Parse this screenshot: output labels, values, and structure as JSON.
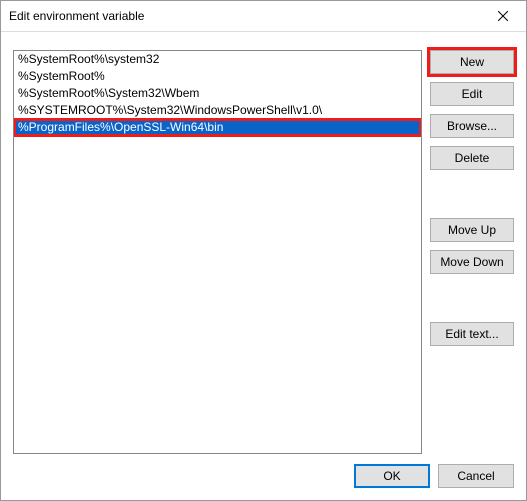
{
  "window": {
    "title": "Edit environment variable"
  },
  "list": {
    "items": [
      {
        "text": "%SystemRoot%\\system32",
        "selected": false,
        "highlight": false
      },
      {
        "text": "%SystemRoot%",
        "selected": false,
        "highlight": false
      },
      {
        "text": "%SystemRoot%\\System32\\Wbem",
        "selected": false,
        "highlight": false
      },
      {
        "text": "%SYSTEMROOT%\\System32\\WindowsPowerShell\\v1.0\\",
        "selected": false,
        "highlight": false
      },
      {
        "text": "%ProgramFiles%\\OpenSSL-Win64\\bin",
        "selected": true,
        "highlight": true
      }
    ]
  },
  "buttons": {
    "new": "New",
    "edit": "Edit",
    "browse": "Browse...",
    "delete": "Delete",
    "moveUp": "Move Up",
    "moveDown": "Move Down",
    "editText": "Edit text...",
    "ok": "OK",
    "cancel": "Cancel"
  },
  "highlight": {
    "newButton": true,
    "selectedRow": true,
    "color": "#ef1c1c"
  },
  "selectionColor": "#0a63c7"
}
